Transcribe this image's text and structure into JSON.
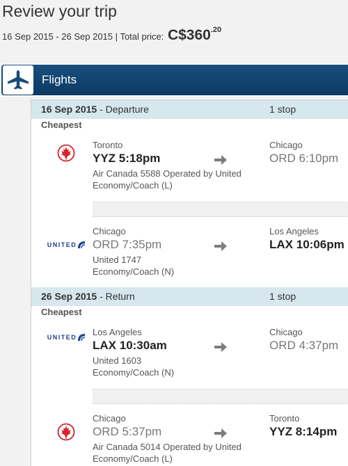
{
  "header": {
    "title": "Review your trip",
    "dates": "16 Sep 2015 - 26 Sep 2015",
    "separator": "|",
    "total_label": "Total price:",
    "price": "C$360",
    "price_cents": ".20"
  },
  "flights_bar": {
    "label": "Flights",
    "icon": "airplane-icon"
  },
  "trips": [
    {
      "date": "16 Sep 2015",
      "direction": "- Departure",
      "stops": "1 stop",
      "tag": "Cheapest",
      "segments": [
        {
          "airline_icon": "air-canada-logo",
          "from_city": "Toronto",
          "from_code": "YYZ",
          "from_time": "5:18pm",
          "to_city": "Chicago",
          "to_code": "ORD",
          "to_time": "6:10pm",
          "carrier": "Air Canada 5588 Operated by United",
          "cabin": "Economy/Coach (L)"
        },
        {
          "airline_icon": "united-logo",
          "from_city": "Chicago",
          "from_code": "ORD",
          "from_time": "7:35pm",
          "to_city": "Los Angeles",
          "to_code": "LAX",
          "to_time": "10:06pm",
          "carrier": "United 1747",
          "cabin": "Economy/Coach (N)"
        }
      ]
    },
    {
      "date": "26 Sep 2015",
      "direction": "- Return",
      "stops": "1 stop",
      "tag": "Cheapest",
      "segments": [
        {
          "airline_icon": "united-logo",
          "from_city": "Los Angeles",
          "from_code": "LAX",
          "from_time": "10:30am",
          "to_city": "Chicago",
          "to_code": "ORD",
          "to_time": "4:37pm",
          "carrier": "United 1603",
          "cabin": "Economy/Coach (N)"
        },
        {
          "airline_icon": "air-canada-logo",
          "from_city": "Chicago",
          "from_code": "ORD",
          "from_time": "5:37pm",
          "to_city": "Toronto",
          "to_code": "YYZ",
          "to_time": "8:14pm",
          "carrier": "Air Canada 5014 Operated by United",
          "cabin": "Economy/Coach (L)"
        }
      ]
    }
  ],
  "logos": {
    "united_text": "UNITED"
  },
  "colors": {
    "bar": "#0b3a63",
    "section_head": "#d6e7ee",
    "air_canada_red": "#d8232a",
    "united_blue": "#1b3f8b"
  }
}
